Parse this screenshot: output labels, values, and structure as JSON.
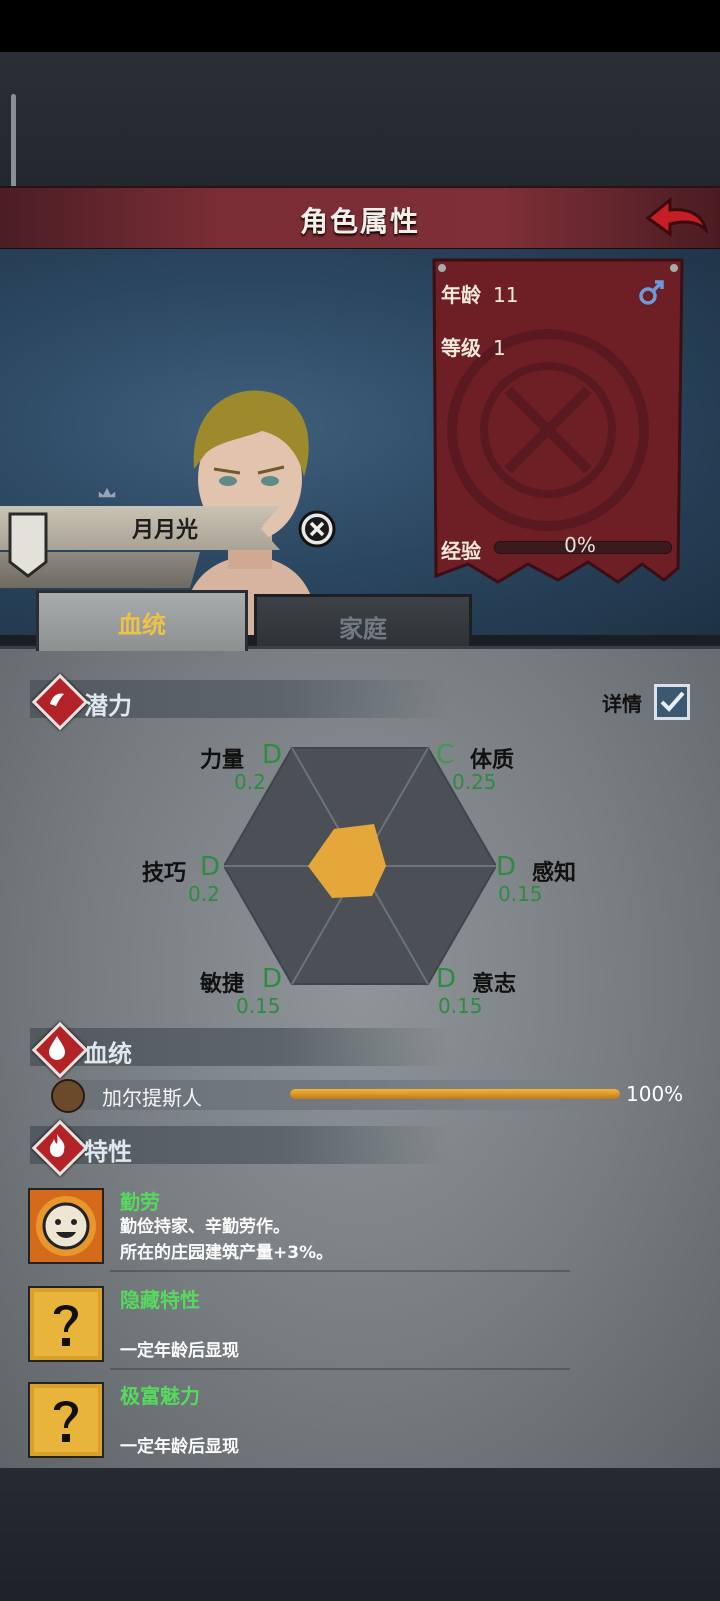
{
  "header": {
    "title": "角色属性"
  },
  "character": {
    "name": "月月光"
  },
  "info": {
    "age_label": "年龄",
    "age": "11",
    "level_label": "等级",
    "level": "1",
    "exp_label": "经验",
    "exp_pct": "0%",
    "exp_fraction": 0
  },
  "tabs": [
    {
      "label": "血统"
    },
    {
      "label": "家庭"
    }
  ],
  "potential": {
    "title": "潜力",
    "detail_label": "详情",
    "stats": [
      {
        "name": "力量",
        "grade": "D",
        "value": "0.2"
      },
      {
        "name": "体质",
        "grade": "C",
        "value": "0.25"
      },
      {
        "name": "技巧",
        "grade": "D",
        "value": "0.2"
      },
      {
        "name": "感知",
        "grade": "D",
        "value": "0.15"
      },
      {
        "name": "敏捷",
        "grade": "D",
        "value": "0.15"
      },
      {
        "name": "意志",
        "grade": "D",
        "value": "0.15"
      }
    ]
  },
  "bloodline": {
    "title": "血统",
    "race": "加尔提斯人",
    "pct": "100%",
    "fraction": 1.0
  },
  "traits": {
    "title": "特性",
    "items": [
      {
        "name": "勤劳",
        "line1": "勤俭持家、辛勤劳作。",
        "line2": "所在的庄园建筑产量+3%。"
      },
      {
        "name": "隐藏特性",
        "line1": "",
        "line2": "一定年龄后显现"
      },
      {
        "name": "极富魅力",
        "line1": "",
        "line2": "一定年龄后显现"
      }
    ]
  },
  "colors": {
    "accent_gold": "#f0c244",
    "grade_green": "#2e8c42",
    "trait_green": "#57d95d",
    "header_red": "#7a2d35"
  }
}
